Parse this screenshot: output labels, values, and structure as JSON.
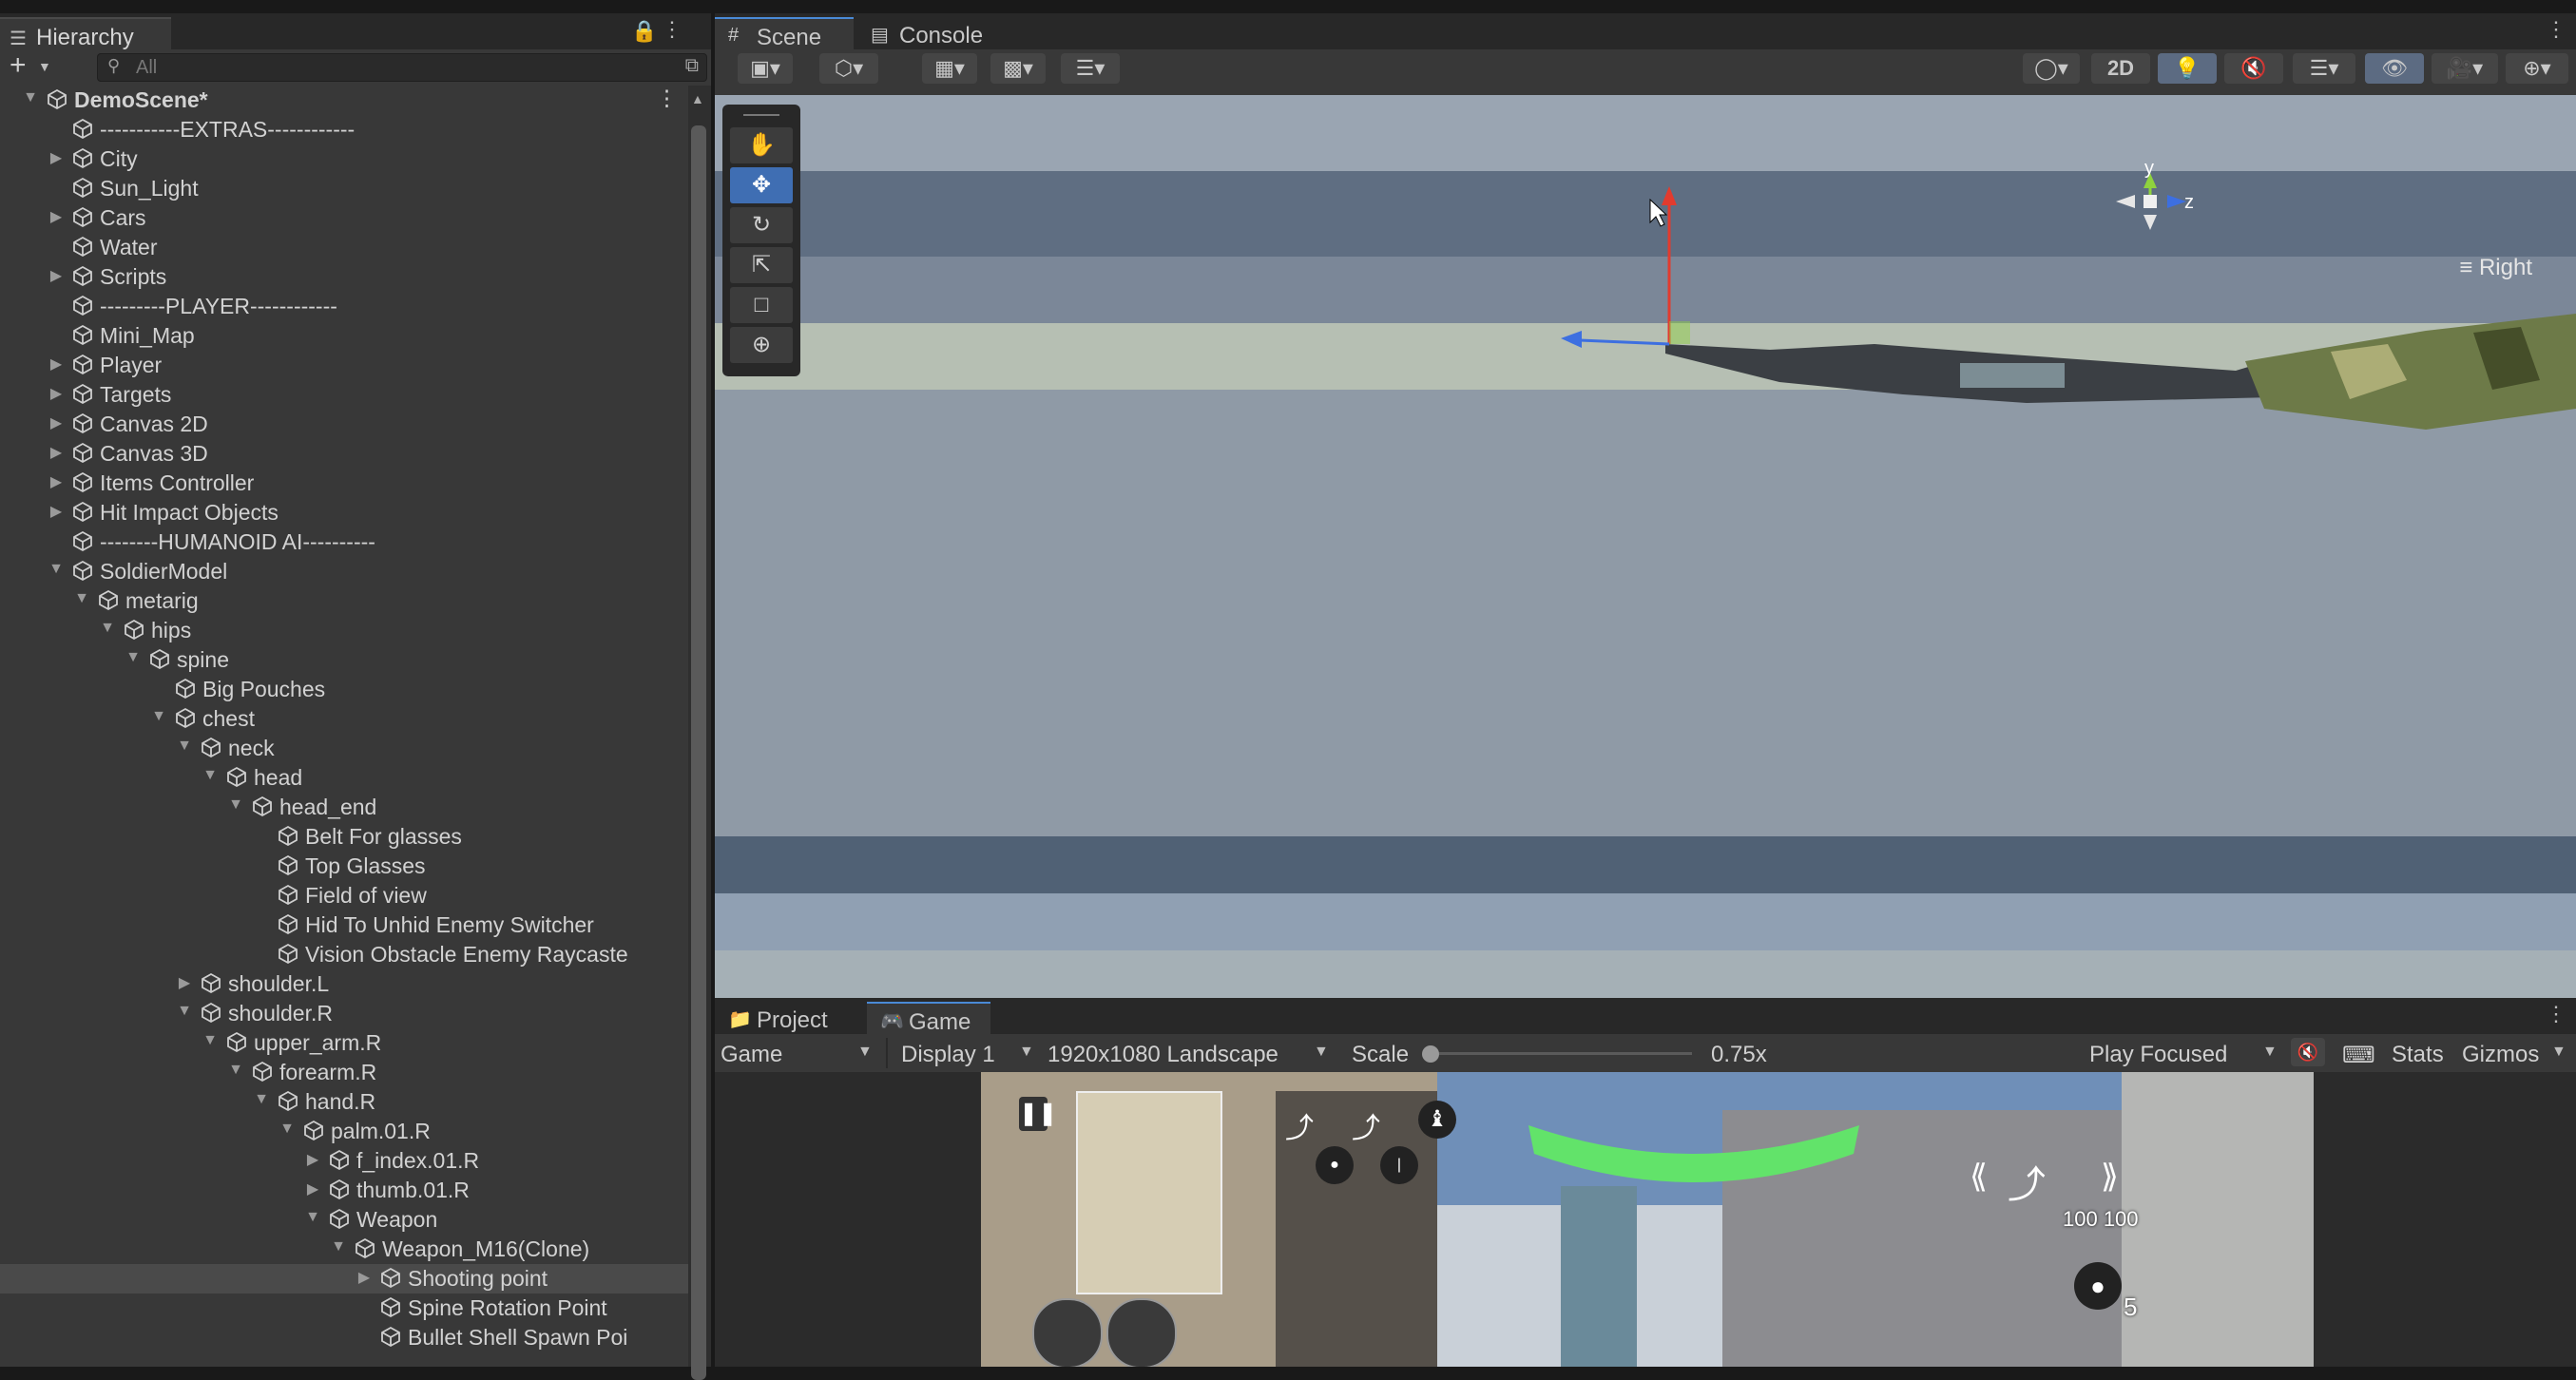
{
  "hierarchy": {
    "tab_label": "Hierarchy",
    "search_placeholder": "All",
    "rows": [
      {
        "label": "DemoScene*",
        "arrow": "▼"
      },
      {
        "label": "-----------EXTRAS------------",
        "arrow": ""
      },
      {
        "label": "City",
        "arrow": "▶"
      },
      {
        "label": "Sun_Light",
        "arrow": ""
      },
      {
        "label": "Cars",
        "arrow": "▶"
      },
      {
        "label": "Water",
        "arrow": ""
      },
      {
        "label": "Scripts",
        "arrow": "▶"
      },
      {
        "label": "---------PLAYER------------",
        "arrow": ""
      },
      {
        "label": "Mini_Map",
        "arrow": ""
      },
      {
        "label": "Player",
        "arrow": "▶"
      },
      {
        "label": "Targets",
        "arrow": "▶"
      },
      {
        "label": "Canvas 2D",
        "arrow": "▶"
      },
      {
        "label": "Canvas 3D",
        "arrow": "▶"
      },
      {
        "label": "Items Controller",
        "arrow": "▶"
      },
      {
        "label": "Hit Impact Objects",
        "arrow": "▶"
      },
      {
        "label": "--------HUMANOID AI----------",
        "arrow": ""
      },
      {
        "label": "SoldierModel",
        "arrow": "▼"
      },
      {
        "label": "metarig",
        "arrow": "▼"
      },
      {
        "label": "hips",
        "arrow": "▼"
      },
      {
        "label": "spine",
        "arrow": "▼"
      },
      {
        "label": "Big Pouches",
        "arrow": ""
      },
      {
        "label": "chest",
        "arrow": "▼"
      },
      {
        "label": "neck",
        "arrow": "▼"
      },
      {
        "label": "head",
        "arrow": "▼"
      },
      {
        "label": "head_end",
        "arrow": "▼"
      },
      {
        "label": "Belt For glasses",
        "arrow": ""
      },
      {
        "label": "Top Glasses",
        "arrow": ""
      },
      {
        "label": "Field of view",
        "arrow": ""
      },
      {
        "label": "Hid To Unhid Enemy Switcher",
        "arrow": ""
      },
      {
        "label": "Vision Obstacle Enemy Raycaste",
        "arrow": ""
      },
      {
        "label": "shoulder.L",
        "arrow": "▶"
      },
      {
        "label": "shoulder.R",
        "arrow": "▼"
      },
      {
        "label": "upper_arm.R",
        "arrow": "▼"
      },
      {
        "label": "forearm.R",
        "arrow": "▼"
      },
      {
        "label": "hand.R",
        "arrow": "▼"
      },
      {
        "label": "palm.01.R",
        "arrow": "▼"
      },
      {
        "label": "f_index.01.R",
        "arrow": "▶"
      },
      {
        "label": "thumb.01.R",
        "arrow": "▶"
      },
      {
        "label": "Weapon",
        "arrow": "▼"
      },
      {
        "label": "Weapon_M16(Clone)",
        "arrow": "▼"
      },
      {
        "label": "Shooting point",
        "arrow": "▶",
        "selected": true
      },
      {
        "label": "Spine Rotation Point",
        "arrow": ""
      },
      {
        "label": "Bullet Shell Spawn Poi",
        "arrow": ""
      }
    ]
  },
  "scene": {
    "tabs": [
      {
        "label": "Scene"
      },
      {
        "label": "Console"
      }
    ],
    "toolbar": {
      "mode_2d": "2D"
    },
    "orientation_label": "Right",
    "gizmo_axes": {
      "y": "y",
      "z": "z"
    }
  },
  "game": {
    "tabs": [
      {
        "label": "Project"
      },
      {
        "label": "Game"
      }
    ],
    "view_select": "Game",
    "display_select": "Display 1",
    "resolution_select": "1920x1080 Landscape",
    "scale_label": "Scale",
    "scale_value": "0.75x",
    "play_mode_select": "Play Focused",
    "stats_label": "Stats",
    "gizmos_label": "Gizmos",
    "scale_level": 0.0,
    "hud": {
      "ammo": "100 100",
      "grenades": "5"
    }
  },
  "colors": {
    "accent": "#3f6eb3",
    "axis_x": "#e23b2e",
    "axis_y": "#8fd23e",
    "axis_z": "#3d6fe0",
    "health": "#62e36a"
  }
}
